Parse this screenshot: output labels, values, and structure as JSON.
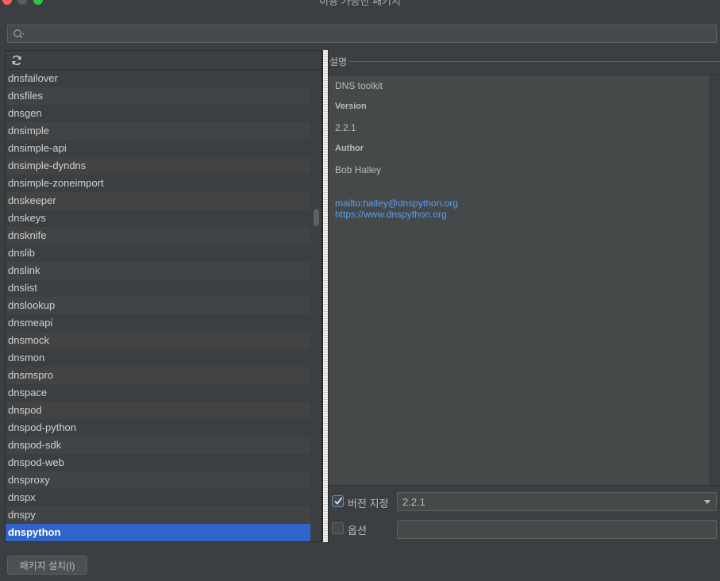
{
  "window": {
    "title": "이용 가능한 패키지"
  },
  "search": {
    "placeholder": "",
    "value": ""
  },
  "packages": [
    "dnsfailover",
    "dnsfiles",
    "dnsgen",
    "dnsimple",
    "dnsimple-api",
    "dnsimple-dyndns",
    "dnsimple-zoneimport",
    "dnskeeper",
    "dnskeys",
    "dnsknife",
    "dnslib",
    "dnslink",
    "dnslist",
    "dnslookup",
    "dnsmeapi",
    "dnsmock",
    "dnsmon",
    "dnsmspro",
    "dnspace",
    "dnspod",
    "dnspod-python",
    "dnspod-sdk",
    "dnspod-web",
    "dnsproxy",
    "dnspx",
    "dnspy",
    "dnspython"
  ],
  "selected_package": "dnspython",
  "description": {
    "header": "설명",
    "summary": "DNS toolkit",
    "version_label": "Version",
    "version_value": "2.2.1",
    "author_label": "Author",
    "author_value": "Bob Halley",
    "email_link": "mailto:halley@dnspython.org",
    "homepage_link": "https://www.dnspython.org"
  },
  "options": {
    "specify_version_label": "버전 지정",
    "specify_version_checked": true,
    "version_selected": "2.2.1",
    "options_label": "옵션",
    "options_checked": false,
    "options_value": ""
  },
  "install_button_label": "패키지 설치(I)",
  "colors": {
    "background": "#3c3f41",
    "selection": "#2f65ca",
    "link": "#589df6",
    "close": "#ff5f57",
    "maximize": "#28c840"
  }
}
